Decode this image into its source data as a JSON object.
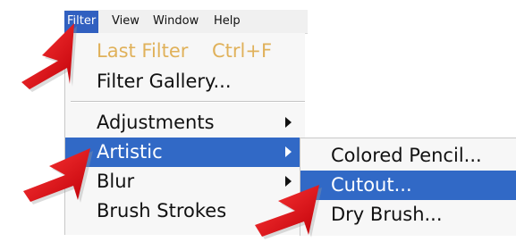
{
  "menubar": {
    "items": [
      {
        "label": "Filter",
        "active": true
      },
      {
        "label": "View"
      },
      {
        "label": "Window"
      },
      {
        "label": "Help"
      }
    ]
  },
  "filter_menu": {
    "last_filter": {
      "label": "Last Filter",
      "shortcut": "Ctrl+F",
      "enabled": false
    },
    "filter_gallery": {
      "label": "Filter Gallery..."
    },
    "adjustments": {
      "label": "Adjustments"
    },
    "artistic": {
      "label": "Artistic",
      "highlighted": true
    },
    "blur": {
      "label": "Blur"
    },
    "brush_strokes": {
      "label": "Brush Strokes"
    }
  },
  "artistic_submenu": {
    "items": [
      {
        "label": "Colored Pencil..."
      },
      {
        "label": "Cutout...",
        "highlighted": true
      },
      {
        "label": "Dry Brush..."
      }
    ]
  },
  "colors": {
    "highlight": "#3169c6",
    "menubar_active": "#3160c0",
    "disabled_text": "#e0b15a",
    "pointer_arrow": "#e8101a"
  },
  "icons": {
    "pointer_arrow": "red-pointer-arrow-icon",
    "submenu_indicator": "triangle-right-icon"
  }
}
